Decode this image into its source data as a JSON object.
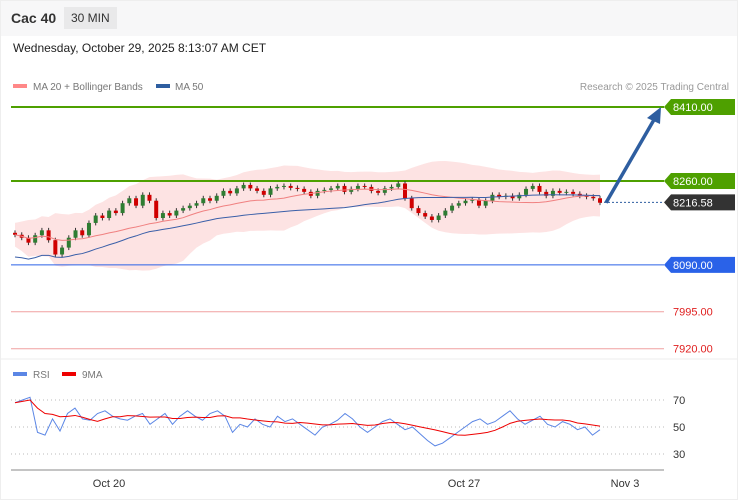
{
  "header": {
    "title": "Cac 40",
    "timeframe": "30 MIN",
    "datetime": "Wednesday, October 29, 2025 8:13:07 AM CET"
  },
  "legend": {
    "ma20": "MA 20 + Bollinger Bands",
    "ma50": "MA 50",
    "credit": "Research © 2025 Trading Central"
  },
  "levels": [
    {
      "label": "8410.00",
      "value": 8410,
      "color": "#4ea000",
      "type": "resistance"
    },
    {
      "label": "8260.00",
      "value": 8260,
      "color": "#4ea000",
      "type": "resistance"
    },
    {
      "label": "8216.58",
      "value": 8216.58,
      "color": "#333333",
      "type": "last"
    },
    {
      "label": "8090.00",
      "value": 8090,
      "color": "#2a62e8",
      "type": "pivot"
    },
    {
      "label": "7995.00",
      "value": 7995,
      "color": "#e02020",
      "type": "support"
    },
    {
      "label": "7920.00",
      "value": 7920,
      "color": "#e02020",
      "type": "support"
    }
  ],
  "rsi": {
    "legend_rsi": "RSI",
    "legend_9ma": "9MA",
    "ticks": [
      "70",
      "50",
      "30"
    ]
  },
  "xaxis": {
    "labels": [
      "Oct 20",
      "Oct 27",
      "Nov 3"
    ]
  },
  "chart_data": {
    "type": "candlestick",
    "closes": [
      8151,
      8145,
      8135,
      8150,
      8160,
      8140,
      8111,
      8125,
      8145,
      8160,
      8150,
      8175,
      8190,
      8185,
      8200,
      8195,
      8215,
      8225,
      8210,
      8232,
      8220,
      8185,
      8195,
      8190,
      8200,
      8205,
      8210,
      8215,
      8225,
      8220,
      8230,
      8240,
      8235,
      8245,
      8252,
      8245,
      8240,
      8232,
      8245,
      8248,
      8250,
      8246,
      8244,
      8238,
      8230,
      8240,
      8242,
      8245,
      8250,
      8238,
      8244,
      8250,
      8248,
      8240,
      8236,
      8245,
      8248,
      8255,
      8225,
      8205,
      8195,
      8188,
      8181,
      8190,
      8200,
      8210,
      8215,
      8220,
      8222,
      8210,
      8220,
      8232,
      8228,
      8230,
      8225,
      8232,
      8244,
      8250,
      8238,
      8230,
      8240,
      8236,
      8238,
      8234,
      8230,
      8228,
      8225,
      8216
    ],
    "rsi": [
      68,
      70,
      72,
      46,
      44,
      56,
      47,
      60,
      64,
      56,
      55,
      60,
      62,
      58,
      56,
      55,
      58,
      60,
      52,
      56,
      60,
      52,
      58,
      62,
      58,
      55,
      60,
      62,
      58,
      46,
      52,
      50,
      56,
      52,
      50,
      58,
      54,
      56,
      52,
      48,
      44,
      50,
      52,
      55,
      60,
      56,
      50,
      46,
      50,
      54,
      56,
      52,
      48,
      50,
      45,
      40,
      36,
      38,
      42,
      46,
      50,
      54,
      56,
      52,
      54,
      58,
      62,
      56,
      52,
      55,
      58,
      52,
      50,
      54,
      52,
      48,
      50,
      44,
      48
    ]
  }
}
